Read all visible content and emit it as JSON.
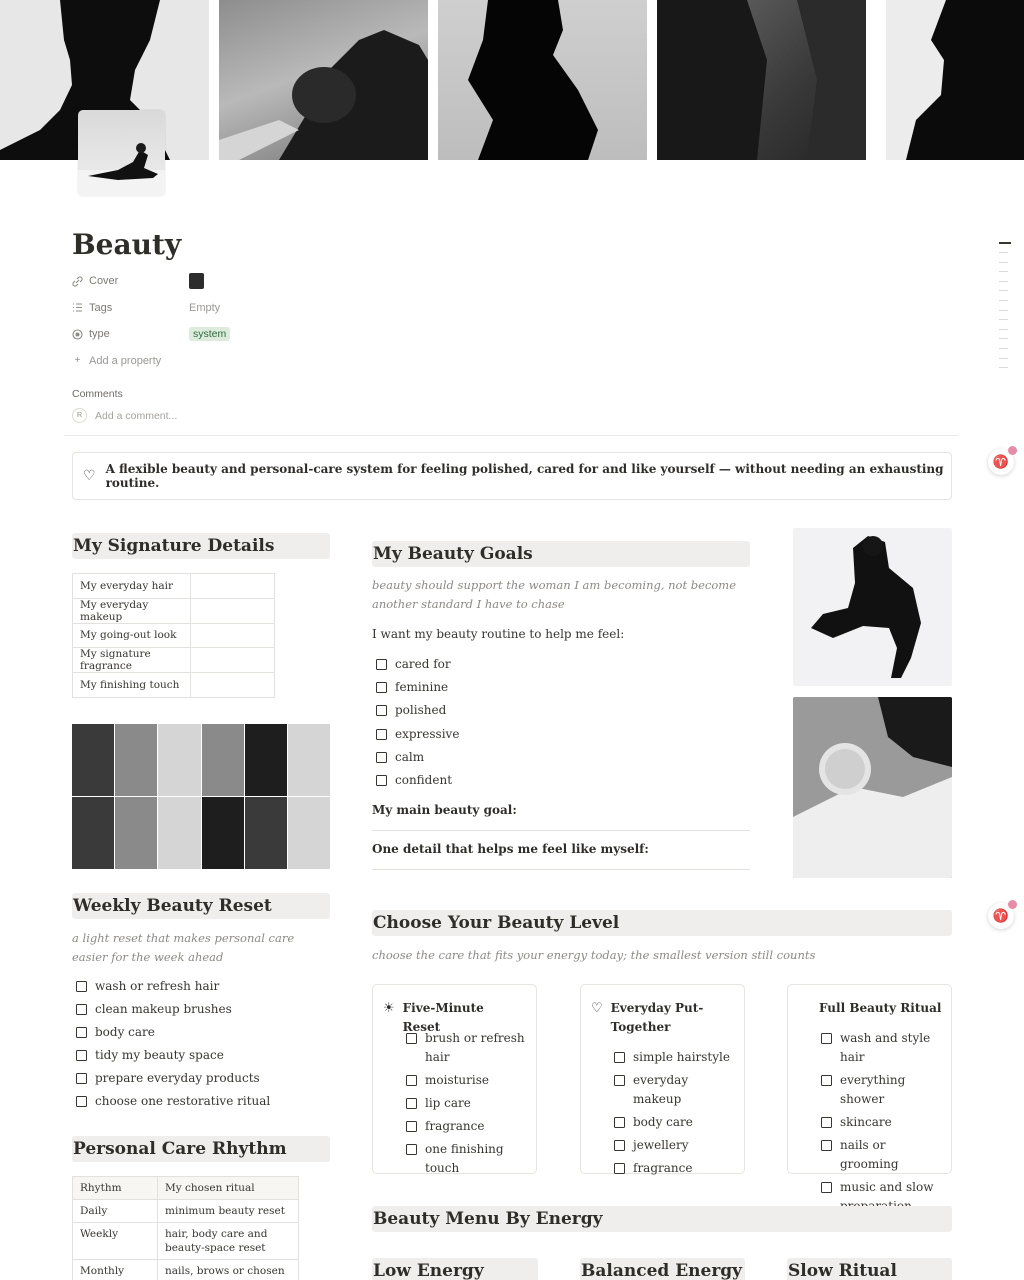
{
  "page": {
    "title": "Beauty",
    "properties": [
      {
        "icon": "link-icon",
        "key": "Cover",
        "type": "thumbnail"
      },
      {
        "icon": "list-icon",
        "key": "Tags",
        "value": "Empty"
      },
      {
        "icon": "status-icon",
        "key": "type",
        "value": "system"
      }
    ],
    "add_property": "Add a property",
    "comments_label": "Comments",
    "comment_avatar": "R",
    "comment_placeholder": "Add a comment..."
  },
  "callout": {
    "icon": "heart-icon",
    "text": "A flexible beauty and personal-care system for feeling polished, cared for and like yourself — without needing an exhausting routine."
  },
  "signature": {
    "heading": "My Signature Details",
    "rows": [
      "My everyday hair",
      "My everyday makeup",
      "My going-out look",
      "My signature fragrance",
      "My finishing touch"
    ]
  },
  "goals": {
    "heading": "My Beauty Goals",
    "subtitle": "beauty should support the woman I am becoming, not become another standard I have to chase",
    "prompt": "I want my beauty routine to help me feel:",
    "items": [
      "cared for",
      "feminine",
      "polished",
      "expressive",
      "calm",
      "confident"
    ],
    "main_goal_label": "My main beauty goal:",
    "detail_label": "One detail that helps me feel like myself:"
  },
  "weekly": {
    "heading": "Weekly Beauty Reset",
    "subtitle": "a light reset that makes personal care easier for the week ahead",
    "items": [
      "wash or refresh hair",
      "clean makeup brushes",
      "body care",
      "tidy my beauty space",
      "prepare everyday products",
      "choose one restorative ritual"
    ]
  },
  "level": {
    "heading": "Choose Your Beauty Level",
    "subtitle": "choose the care that fits your energy today; the smallest version still counts",
    "cards": [
      {
        "icon": "sun-icon",
        "glyph": "☀",
        "title": "Five-Minute Reset",
        "items": [
          "brush or refresh hair",
          "moisturise",
          "lip care",
          "fragrance",
          "one finishing touch"
        ]
      },
      {
        "icon": "heart-icon",
        "glyph": "♡",
        "title": "Everyday Put-Together",
        "items": [
          "simple hairstyle",
          "everyday makeup",
          "body care",
          "jewellery",
          "fragrance"
        ]
      },
      {
        "icon": "",
        "glyph": "",
        "title": "Full Beauty Ritual",
        "items": [
          "wash and style hair",
          "everything shower",
          "skincare",
          "nails or grooming",
          "music and slow preparation"
        ]
      }
    ]
  },
  "rhythm": {
    "heading": "Personal Care Rhythm",
    "header": [
      "Rhythm",
      "My chosen ritual"
    ],
    "rows": [
      [
        "Daily",
        "minimum beauty reset"
      ],
      [
        "Weekly",
        "hair, body care and beauty-space reset"
      ],
      [
        "Monthly",
        "nails, brows or chosen"
      ]
    ]
  },
  "menu": {
    "heading": "Beauty Menu By Energy",
    "columns": [
      "Low Energy",
      "Balanced Energy",
      "Slow Ritual"
    ]
  },
  "floating": {
    "glyph": "♈"
  }
}
